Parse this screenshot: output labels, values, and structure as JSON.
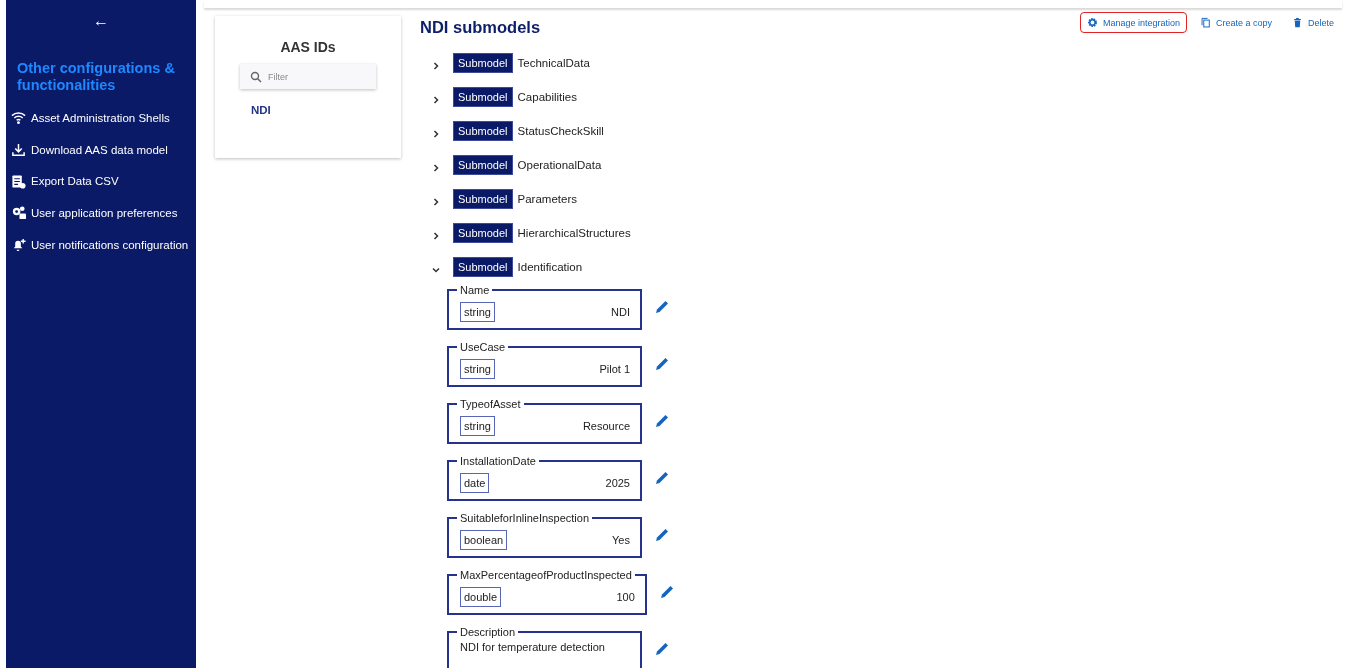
{
  "sidebar": {
    "back_label": "←",
    "heading": "Other configurations & functionalities",
    "items": [
      {
        "label": "Asset Administration Shells"
      },
      {
        "label": "Download AAS data model"
      },
      {
        "label": "Export Data CSV"
      },
      {
        "label": "User application preferences"
      },
      {
        "label": "User notifications configuration"
      }
    ]
  },
  "aas_panel": {
    "title": "AAS IDs",
    "filter": {
      "placeholder": "Filter"
    },
    "ids": [
      "NDI"
    ]
  },
  "main": {
    "title": "NDI submodels",
    "actions": [
      {
        "label": "Manage integration",
        "highlighted": true
      },
      {
        "label": "Create a copy",
        "highlighted": false
      },
      {
        "label": "Delete",
        "highlighted": false
      }
    ],
    "submodels": [
      {
        "tag": "Submodel",
        "name": "TechnicalData",
        "expanded": false
      },
      {
        "tag": "Submodel",
        "name": "Capabilities",
        "expanded": false
      },
      {
        "tag": "Submodel",
        "name": "StatusCheckSkill",
        "expanded": false
      },
      {
        "tag": "Submodel",
        "name": "OperationalData",
        "expanded": false
      },
      {
        "tag": "Submodel",
        "name": "Parameters",
        "expanded": false
      },
      {
        "tag": "Submodel",
        "name": "HierarchicalStructures",
        "expanded": false
      },
      {
        "tag": "Submodel",
        "name": "Identification",
        "expanded": true,
        "properties": [
          {
            "kind": "typed",
            "label": "Name",
            "type": "string",
            "value": "NDI"
          },
          {
            "kind": "typed",
            "label": "UseCase",
            "type": "string",
            "value": "Pilot 1"
          },
          {
            "kind": "typed",
            "label": "TypeofAsset",
            "type": "string",
            "value": "Resource"
          },
          {
            "kind": "typed",
            "label": "InstallationDate",
            "type": "date",
            "value": "2025"
          },
          {
            "kind": "typed",
            "label": "SuitableforInlineInspection",
            "type": "boolean",
            "value": "Yes"
          },
          {
            "kind": "typed",
            "label": "MaxPercentageofProductInspected",
            "type": "double",
            "value": "100"
          },
          {
            "kind": "text",
            "label": "Description",
            "value": "NDI for temperature detection"
          }
        ]
      }
    ]
  }
}
